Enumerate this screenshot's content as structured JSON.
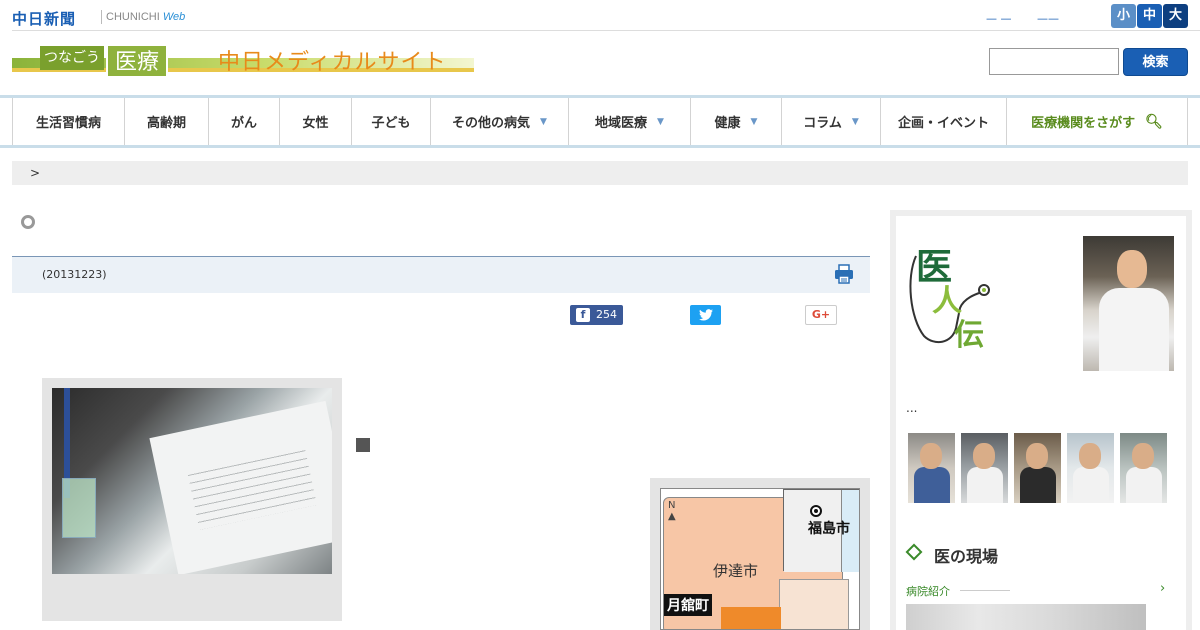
{
  "header": {
    "logo_text": "中日新聞",
    "logo_sub": "CHUNICHI",
    "logo_web": "Web",
    "font_links": [
      "— —",
      "——"
    ],
    "font_sizes": [
      {
        "label": "小",
        "color": "#5b8fc7"
      },
      {
        "label": "中",
        "color": "#1a5fb4"
      },
      {
        "label": "大",
        "color": "#0d3f80"
      }
    ]
  },
  "banner": {
    "tagline": "つなごう",
    "iryo": "医療",
    "site_name": "中日メディカルサイト"
  },
  "search": {
    "placeholder": "",
    "button_label": "検索"
  },
  "nav": {
    "items": [
      {
        "label": "生活習慣病",
        "caret": false
      },
      {
        "label": "高齢期",
        "caret": false
      },
      {
        "label": "がん",
        "caret": false
      },
      {
        "label": "女性",
        "caret": false
      },
      {
        "label": "子ども",
        "caret": false
      },
      {
        "label": "その他の病気",
        "caret": true
      },
      {
        "label": "地域医療",
        "caret": true
      },
      {
        "label": "健康",
        "caret": true
      },
      {
        "label": "コラム",
        "caret": true
      },
      {
        "label": "企画・イベント",
        "caret": false
      }
    ],
    "hospital_search": "医療機関をさがす"
  },
  "breadcrumb": {
    "separator": ">"
  },
  "article": {
    "date": "(20131223)",
    "facebook_count": "254",
    "facebook_icon": "facebook-icon",
    "twitter_icon": "twitter-icon",
    "googleplus_label": "G+"
  },
  "map": {
    "north_label": "N",
    "city_date": "伊達市",
    "city_fukushima": "福島市",
    "town_tsukidate": "月舘町"
  },
  "sidebar": {
    "logo_chars": [
      "医",
      "人",
      "伝"
    ],
    "ellipsis": "...",
    "section_title": "医の現場",
    "hospital_link": "病院紹介",
    "arrow": "›"
  }
}
